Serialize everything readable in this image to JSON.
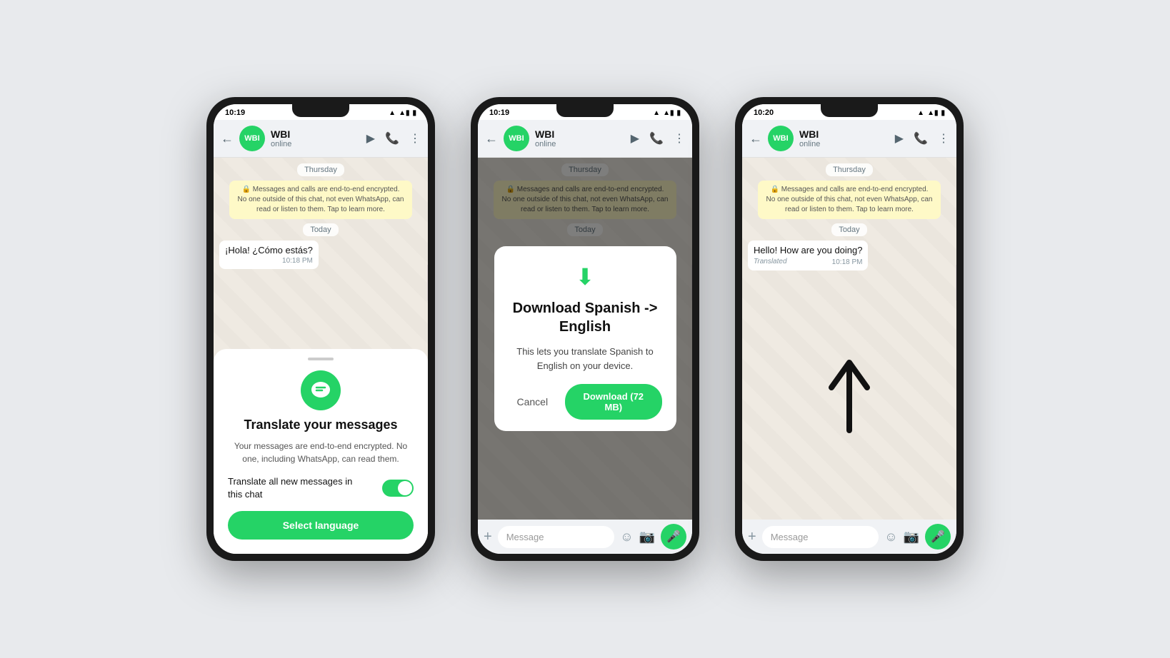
{
  "page": {
    "bg": "#e8eaed"
  },
  "phone1": {
    "time": "10:19",
    "contact_name": "WBI",
    "contact_status": "online",
    "date_divider1": "Thursday",
    "date_divider2": "Today",
    "system_msg": "🔒 Messages and calls are end-to-end encrypted. No one outside of this chat, not even WhatsApp, can read or listen to them. Tap to learn more.",
    "message_text": "¡Hola! ¿Cómo estás?",
    "message_time": "10:18 PM",
    "sheet_title": "Translate your messages",
    "sheet_desc": "Your messages are end-to-end encrypted. No one, including WhatsApp, can read them.",
    "toggle_label": "Translate all new messages in this chat",
    "select_lang_btn": "Select language",
    "avatar_text": "WBI"
  },
  "phone2": {
    "time": "10:19",
    "contact_name": "WBI",
    "contact_status": "online",
    "date_divider1": "Thursday",
    "date_divider2": "Today",
    "system_msg": "🔒 Messages and calls are end-to-end encrypted. No one outside of this chat, not even WhatsApp, can read or listen to them. Tap to learn more.",
    "dialog_title": "Download Spanish -> English",
    "dialog_desc": "This lets you translate Spanish to English on your device.",
    "cancel_btn": "Cancel",
    "download_btn": "Download (72 MB)",
    "avatar_text": "WBI"
  },
  "phone3": {
    "time": "10:20",
    "contact_name": "WBI",
    "contact_status": "online",
    "date_divider1": "Thursday",
    "date_divider2": "Today",
    "system_msg": "🔒 Messages and calls are end-to-end encrypted. No one outside of this chat, not even WhatsApp, can read or listen to them. Tap to learn more.",
    "message_text": "Hello! How are you doing?",
    "message_translated": "Translated",
    "message_time": "10:18 PM",
    "message_placeholder": "Message",
    "avatar_text": "WBI"
  },
  "icons": {
    "back": "←",
    "video": "🎥",
    "phone": "📞",
    "more": "⋮",
    "emoji": "☺",
    "camera": "📷",
    "mic": "🎤",
    "plus": "+",
    "wifi": "▲",
    "signal": "▲",
    "battery": "▮",
    "download_icon": "⬇"
  }
}
